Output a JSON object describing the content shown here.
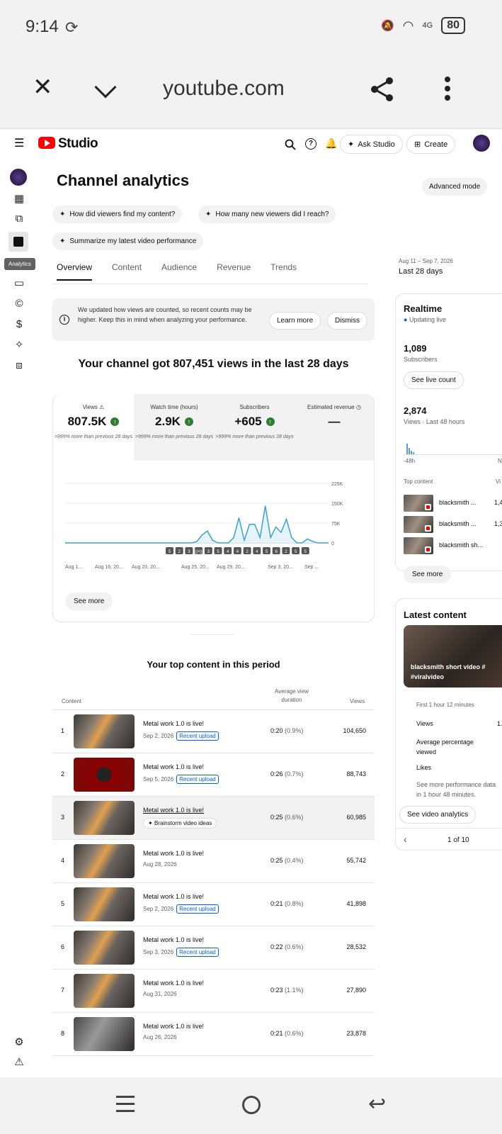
{
  "status": {
    "time": "9:14",
    "network": "4G",
    "battery": "80"
  },
  "browser": {
    "url": "youtube.com"
  },
  "header": {
    "logo": "Studio",
    "ask": "Ask Studio",
    "create": "Create"
  },
  "sidebar": {
    "tooltip": "Analytics"
  },
  "page": {
    "title": "Channel analytics",
    "advanced": "Advanced mode",
    "prompts": [
      "How did viewers find my content?",
      "How many new viewers did I reach?",
      "Summarize my latest video performance"
    ],
    "tabs": [
      "Overview",
      "Content",
      "Audience",
      "Revenue",
      "Trends"
    ],
    "range_dates": "Aug 11 – Sep 7, 2026",
    "range_label": "Last 28 days"
  },
  "notice": {
    "text": "We updated how views are counted, so recent counts may be higher. Keep this in mind when analyzing your performance.",
    "learn": "Learn more",
    "dismiss": "Dismiss"
  },
  "summary": "Your channel got 807,451 views in the last 28 days",
  "metrics": [
    {
      "label": "Views",
      "value": "807.5K",
      "sub": ">999% more than previous 28 days"
    },
    {
      "label": "Watch time (hours)",
      "value": "2.9K",
      "sub": ">999% more than previous 28 days"
    },
    {
      "label": "Subscribers",
      "value": "+605",
      "sub": ">999% more than previous 28 days"
    },
    {
      "label": "Estimated revenue",
      "value": "—",
      "sub": ""
    }
  ],
  "chart_data": {
    "type": "area",
    "y_ticks": [
      "225K",
      "150K",
      "75K",
      "0"
    ],
    "ylim": [
      0,
      225000
    ],
    "x_labels": [
      "Aug 1...",
      "Aug 16, 20...",
      "Aug 20, 20...",
      "Aug 25, 20...",
      "Aug 29, 20...",
      "Sep 3, 20...",
      "Sep ..."
    ],
    "values": [
      0,
      0,
      0,
      0,
      0,
      0,
      0,
      0,
      0,
      0,
      0,
      0,
      0,
      0,
      0,
      0,
      0,
      0,
      0,
      0,
      0,
      0,
      0,
      0,
      0,
      5000,
      30000,
      45000,
      10000,
      0,
      0,
      0,
      20000,
      95000,
      10000,
      70000,
      70000,
      20000,
      140000,
      20000,
      60000,
      40000,
      90000,
      20000,
      0,
      0,
      15000,
      5000,
      0,
      0,
      0
    ],
    "markers": [
      "5",
      "2",
      "3",
      "((•))",
      "3",
      "5",
      "4",
      "4",
      "2",
      "4",
      "5",
      "6",
      "2",
      "5",
      "5"
    ]
  },
  "see_more": "See more",
  "top_content": {
    "title": "Your top content in this period",
    "col_content": "Content",
    "col_avg": "Average view duration",
    "col_views": "Views",
    "rows": [
      {
        "n": "1",
        "title": "Metal work 1.0 is live!",
        "date": "Sep 2, 2026",
        "tag": "Recent upload",
        "avg": "0:20",
        "pct": "(0.9%)",
        "views": "104,650",
        "style": "forge"
      },
      {
        "n": "2",
        "title": "Metal work 1.0 is live!",
        "date": "Sep 5, 2026",
        "tag": "Recent upload",
        "avg": "0:26",
        "pct": "(0.7%)",
        "views": "88,743",
        "style": "red"
      },
      {
        "n": "3",
        "title": "Metal work 1.0 is live!",
        "date": "",
        "tag": "",
        "extra": "Brainstorm video ideas",
        "avg": "0:25",
        "pct": "(0.6%)",
        "views": "60,985",
        "style": "forge"
      },
      {
        "n": "4",
        "title": "Metal work 1.0 is live!",
        "date": "Aug 28, 2026",
        "tag": "",
        "avg": "0:25",
        "pct": "(0.4%)",
        "views": "55,742",
        "style": "forge"
      },
      {
        "n": "5",
        "title": "Metal work 1.0 is live!",
        "date": "Sep 2, 2026",
        "tag": "Recent upload",
        "avg": "0:21",
        "pct": "(0.8%)",
        "views": "41,898",
        "style": "forge"
      },
      {
        "n": "6",
        "title": "Metal work 1.0 is live!",
        "date": "Sep 3, 2026",
        "tag": "Recent upload",
        "avg": "0:22",
        "pct": "(0.6%)",
        "views": "28,532",
        "style": "forge"
      },
      {
        "n": "7",
        "title": "Metal work 1.0 is live!",
        "date": "Aug 31, 2026",
        "tag": "",
        "avg": "0:23",
        "pct": "(1.1%)",
        "views": "27,890",
        "style": "forge"
      },
      {
        "n": "8",
        "title": "Metal work 1.0 is live!",
        "date": "Aug 26, 2026",
        "tag": "",
        "avg": "0:21",
        "pct": "(0.6%)",
        "views": "23,878",
        "style": "dark"
      }
    ]
  },
  "realtime": {
    "title": "Realtime",
    "updating": "Updating live",
    "subs": "1,089",
    "subs_label": "Subscribers",
    "live_btn": "See live count",
    "views": "2,874",
    "views_label": "Views · Last 48 hours",
    "axis_left": "-48h",
    "axis_right": "N",
    "top_content": "Top content",
    "views_col": "Vi",
    "items": [
      {
        "title": "blacksmith ...",
        "v": "1,4"
      },
      {
        "title": "blacksmith ...",
        "v": "1,3"
      },
      {
        "title": "blacksmith sh...",
        "v": ""
      }
    ],
    "see_more": "See more"
  },
  "latest": {
    "title": "Latest content",
    "video_title": "blacksmith short video # #viralvideo",
    "period": "First 1 hour 12 minutes",
    "views_label": "Views",
    "views_val": "1.",
    "avg_label": "Average percentage viewed",
    "likes_label": "Likes",
    "note": "See more performance data in 1 hour 48 minutes.",
    "btn": "See video analytics",
    "pager": "1 of 10"
  }
}
